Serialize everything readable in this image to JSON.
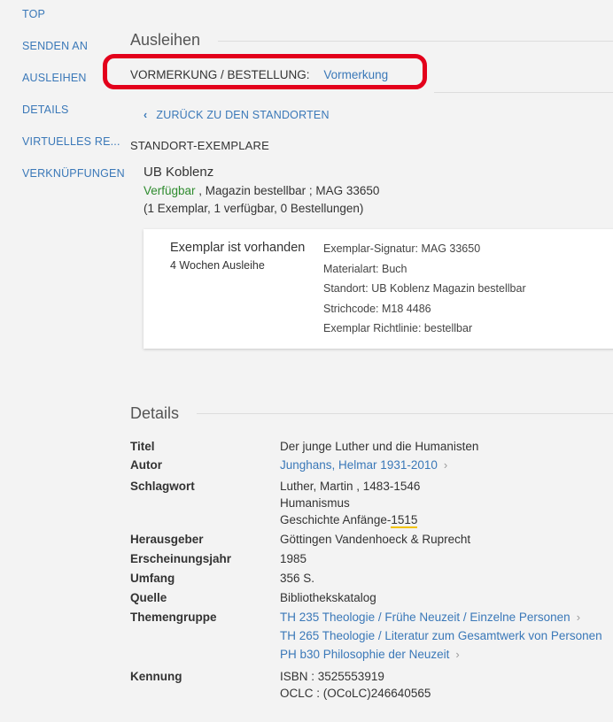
{
  "sidebar": {
    "items": [
      {
        "label": "TOP"
      },
      {
        "label": "SENDEN AN"
      },
      {
        "label": "AUSLEIHEN"
      },
      {
        "label": "DETAILS"
      },
      {
        "label": "VIRTUELLES RE..."
      },
      {
        "label": "VERKNÜPFUNGEN"
      }
    ]
  },
  "loan": {
    "title": "Ausleihen",
    "request_label": "VORMERKUNG / BESTELLUNG:",
    "request_value": "Vormerkung",
    "back_label": "ZURÜCK ZU DEN STANDORTEN",
    "items_heading": "STANDORT-EXEMPLARE",
    "location": {
      "name": "UB Koblenz",
      "status": "Verfügbar",
      "status_rest": " , Magazin bestellbar ; MAG 33650",
      "counts": "(1 Exemplar, 1 verfügbar, 0 Bestellungen)"
    },
    "item": {
      "availability": "Exemplar ist vorhanden",
      "policy": "4 Wochen Ausleihe",
      "attributes": [
        "Exemplar-Signatur: MAG 33650",
        "Materialart: Buch",
        "Standort: UB Koblenz Magazin bestellbar",
        "Strichcode: M18 4486",
        "Exemplar Richtlinie: bestellbar"
      ]
    }
  },
  "details": {
    "title": "Details",
    "rows": {
      "titel": {
        "label": "Titel",
        "value": "Der junge Luther und die Humanisten"
      },
      "autor": {
        "label": "Autor",
        "value": "Junghans, Helmar 1931-2010"
      },
      "schlagwort": {
        "label": "Schlagwort",
        "values": [
          "Luther, Martin , 1483-1546",
          "Humanismus",
          "Geschichte Anfänge-",
          "1515"
        ]
      },
      "herausgeber": {
        "label": "Herausgeber",
        "value": "Göttingen Vandenhoeck & Ruprecht"
      },
      "jahr": {
        "label": "Erscheinungsjahr",
        "value": "1985"
      },
      "umfang": {
        "label": "Umfang",
        "value": "356 S."
      },
      "quelle": {
        "label": "Quelle",
        "value": "Bibliothekskatalog"
      },
      "themengruppe": {
        "label": "Themengruppe",
        "values": [
          "TH 235 Theologie / Frühe Neuzeit / Einzelne Personen",
          "TH 265 Theologie / Literatur zum Gesamtwerk von Personen",
          "PH b30 Philosophie der Neuzeit"
        ]
      },
      "kennung": {
        "label": "Kennung",
        "values": [
          "ISBN : 3525553919",
          "OCLC : (OCoLC)246640565"
        ]
      }
    }
  },
  "colors": {
    "link": "#3a78b8",
    "highlight": "#e3001b",
    "available": "#2e8b2e"
  }
}
